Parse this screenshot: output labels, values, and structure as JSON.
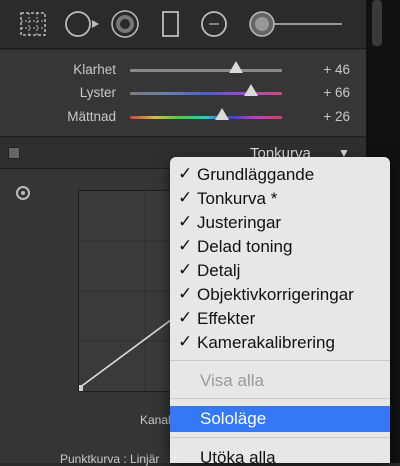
{
  "toolstrip": {
    "tools": [
      "crop-overlay-icon",
      "spot-removal-icon",
      "red-eye-icon",
      "graduated-filter-icon",
      "radial-filter-icon",
      "adjustment-brush-icon"
    ]
  },
  "presence": {
    "sliders": [
      {
        "label": "Klarhet",
        "value": "+ 46",
        "level": 0.73
      },
      {
        "label": "Lyster",
        "value": "+ 66",
        "level": 0.83
      },
      {
        "label": "Mättnad",
        "value": "+ 26",
        "level": 0.63
      }
    ]
  },
  "tone_curve": {
    "title": "Tonkurva",
    "channel_label": "Kanal",
    "point_curve_label": "Punktkurva :  Linjär"
  },
  "menu": {
    "checked_items": [
      "Grundläggande",
      "Tonkurva *",
      "Justeringar",
      "Delad toning",
      "Detalj",
      "Objektivkorrigeringar",
      "Effekter",
      "Kamerakalibrering"
    ],
    "check_mark": "✓",
    "show_all": "Visa alla",
    "solo_mode": "Sololäge",
    "expand_all": "Utöka alla"
  },
  "colors": {
    "menu_bg": "#e7e7e7",
    "highlight": "#3478f6",
    "panel_bg": "#363636"
  }
}
